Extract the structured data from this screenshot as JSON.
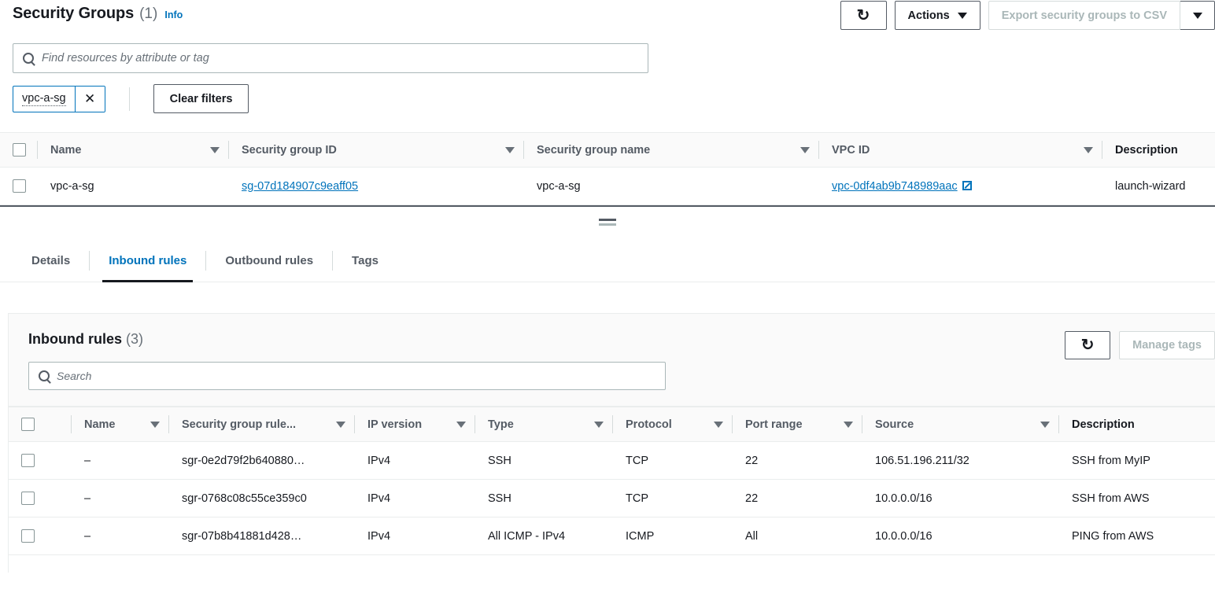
{
  "header": {
    "title": "Security Groups",
    "count": "(1)",
    "info_label": "Info",
    "refresh_icon": "refresh-icon",
    "actions_label": "Actions",
    "export_label": "Export security groups to CSV",
    "export_disabled": true
  },
  "search": {
    "placeholder": "Find resources by attribute or tag",
    "value": "",
    "icon": "search-icon"
  },
  "filters": {
    "token_label": "vpc-a-sg",
    "remove_icon": "close-icon",
    "clear_label": "Clear filters"
  },
  "main_table": {
    "columns": [
      {
        "label": "Name",
        "sortable": true
      },
      {
        "label": "Security group ID",
        "sortable": true
      },
      {
        "label": "Security group name",
        "sortable": true
      },
      {
        "label": "VPC ID",
        "sortable": true
      },
      {
        "label": "Description",
        "sortable": false
      }
    ],
    "rows": [
      {
        "name": "vpc-a-sg",
        "group_id": "sg-07d184907c9eaff05",
        "group_name": "vpc-a-sg",
        "vpc_id": "vpc-0df4ab9b748989aac",
        "description": "launch-wizard"
      }
    ]
  },
  "splitter": {
    "handle_icon": "drag-handle-icon"
  },
  "tabs": {
    "items": [
      {
        "label": "Details",
        "active": false
      },
      {
        "label": "Inbound rules",
        "active": true
      },
      {
        "label": "Outbound rules",
        "active": false
      },
      {
        "label": "Tags",
        "active": false
      }
    ]
  },
  "inbound_panel": {
    "title": "Inbound rules",
    "count": "(3)",
    "search_placeholder": "Search",
    "search_value": "",
    "refresh_icon": "refresh-icon",
    "manage_tags_label": "Manage tags",
    "manage_tags_disabled": true,
    "columns": [
      {
        "label": "Name",
        "sortable": true
      },
      {
        "label": "Security group rule...",
        "sortable": true
      },
      {
        "label": "IP version",
        "sortable": true
      },
      {
        "label": "Type",
        "sortable": true
      },
      {
        "label": "Protocol",
        "sortable": true
      },
      {
        "label": "Port range",
        "sortable": true
      },
      {
        "label": "Source",
        "sortable": true
      },
      {
        "label": "Description",
        "sortable": false
      }
    ],
    "rows": [
      {
        "name": "–",
        "rule_id": "sgr-0e2d79f2b640880…",
        "ip_version": "IPv4",
        "type": "SSH",
        "protocol": "TCP",
        "port_range": "22",
        "source": "106.51.196.211/32",
        "description": "SSH from MyIP"
      },
      {
        "name": "–",
        "rule_id": "sgr-0768c08c55ce359c0",
        "ip_version": "IPv4",
        "type": "SSH",
        "protocol": "TCP",
        "port_range": "22",
        "source": "10.0.0.0/16",
        "description": "SSH from AWS"
      },
      {
        "name": "–",
        "rule_id": "sgr-07b8b41881d428…",
        "ip_version": "IPv4",
        "type": "All ICMP - IPv4",
        "protocol": "ICMP",
        "port_range": "All",
        "source": "10.0.0.0/16",
        "description": "PING from AWS"
      }
    ]
  },
  "colors": {
    "link": "#0073bb",
    "text": "#16191f",
    "muted": "#687078",
    "border": "#eaeded",
    "header_bg": "#fafafa"
  }
}
